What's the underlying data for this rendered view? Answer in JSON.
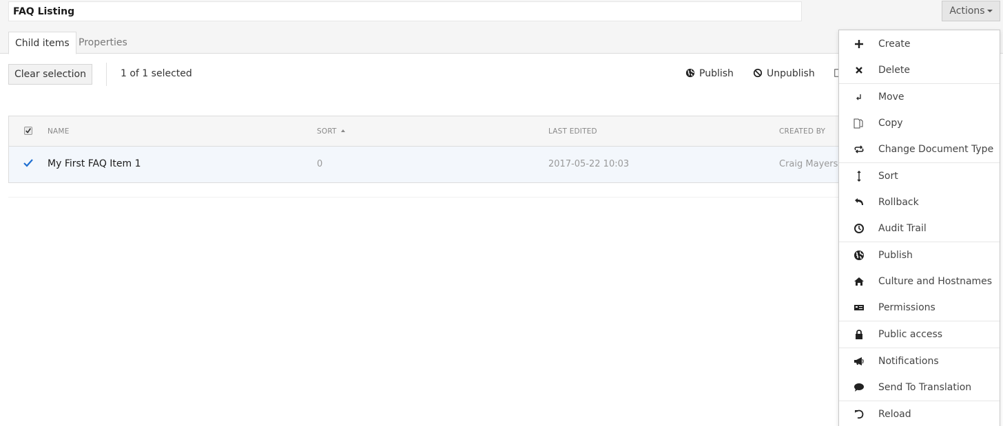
{
  "header": {
    "node_name": "FAQ Listing",
    "actions_label": "Actions"
  },
  "tabs": [
    {
      "label": "Child items",
      "active": true
    },
    {
      "label": "Properties",
      "active": false
    }
  ],
  "toolbar": {
    "clear_selection_label": "Clear selection",
    "selection_status": "1 of 1 selected",
    "actions": [
      {
        "label": "Publish",
        "icon": "globe-icon"
      },
      {
        "label": "Unpublish",
        "icon": "block-icon"
      }
    ]
  },
  "table": {
    "columns": [
      "NAME",
      "SORT",
      "LAST EDITED",
      "CREATED BY"
    ],
    "sorted_column": "SORT",
    "sort_direction": "ascending",
    "rows": [
      {
        "name": "My First FAQ Item 1",
        "sort": "0",
        "last_edited": "2017-05-22 10:03",
        "created_by": "Craig Mayers",
        "selected": true
      }
    ]
  },
  "actions_menu": {
    "items": [
      {
        "label": "Create",
        "icon": "plus-icon"
      },
      {
        "label": "Delete",
        "icon": "delete-x-icon"
      },
      {
        "label": "Move",
        "icon": "move-arrow-icon"
      },
      {
        "label": "Copy",
        "icon": "copy-document-icon"
      },
      {
        "label": "Change Document Type",
        "icon": "exchange-icon"
      },
      {
        "label": "Sort",
        "icon": "sort-vertical-icon"
      },
      {
        "label": "Rollback",
        "icon": "undo-icon"
      },
      {
        "label": "Audit Trail",
        "icon": "clock-icon"
      },
      {
        "label": "Publish",
        "icon": "globe-icon"
      },
      {
        "label": "Culture and Hostnames",
        "icon": "home-icon"
      },
      {
        "label": "Permissions",
        "icon": "permissions-card-icon"
      },
      {
        "label": "Public access",
        "icon": "lock-icon"
      },
      {
        "label": "Notifications",
        "icon": "megaphone-icon"
      },
      {
        "label": "Send To Translation",
        "icon": "speech-bubble-icon"
      },
      {
        "label": "Reload",
        "icon": "reload-icon"
      }
    ]
  },
  "colors": {
    "accent": "#1f6fd1",
    "selected_row_bg": "#f3f7fc",
    "header_bg": "#f5f5f5"
  }
}
